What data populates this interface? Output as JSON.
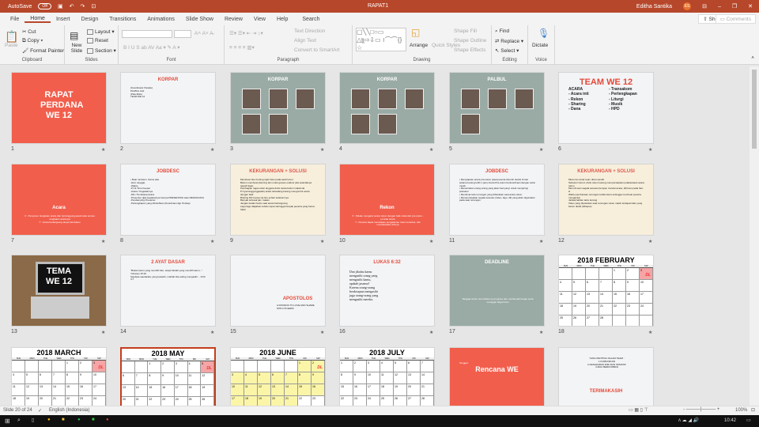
{
  "titlebar": {
    "autosave": "AutoSave",
    "autosave_state": "Off",
    "doc_title": "RAPAT1",
    "user": "Editha Santika",
    "user_initials": "ES"
  },
  "tabs": [
    "File",
    "Home",
    "Insert",
    "Design",
    "Transitions",
    "Animations",
    "Slide Show",
    "Review",
    "View",
    "Help",
    "Search"
  ],
  "share": "Share",
  "comments": "Comments",
  "ribbon": {
    "clipboard": {
      "label": "Clipboard",
      "paste": "Paste",
      "cut": "Cut",
      "copy": "Copy",
      "format_painter": "Format Painter"
    },
    "slides": {
      "label": "Slides",
      "new_slide": "New Slide",
      "layout": "Layout",
      "reset": "Reset",
      "section": "Section"
    },
    "font": {
      "label": "Font"
    },
    "paragraph": {
      "label": "Paragraph",
      "text_direction": "Text Direction",
      "align_text": "Align Text",
      "smartart": "Convert to SmartArt"
    },
    "drawing": {
      "label": "Drawing",
      "arrange": "Arrange",
      "quick_styles": "Quick Styles",
      "shape_fill": "Shape Fill",
      "shape_outline": "Shape Outline",
      "shape_effects": "Shape Effects"
    },
    "editing": {
      "label": "Editing",
      "find": "Find",
      "replace": "Replace",
      "select": "Select"
    },
    "voice": {
      "label": "Voice",
      "dictate": "Dictate"
    }
  },
  "colors": {
    "accent": "#b7472a",
    "coral": "#f25e4c",
    "sage": "#9aaba6",
    "cream": "#f7efdc",
    "light": "#f3f4f6"
  },
  "slides": [
    {
      "n": "1",
      "bg": "coral",
      "title": "RAPAT PERDANA WE 12"
    },
    {
      "n": "2",
      "bg": "light",
      "title": "KORPAR",
      "body": [
        "(Koordinator Parade)",
        "PALBUL 1&2",
        "(Palu-Bulu)",
        "TEAM WE 12"
      ]
    },
    {
      "n": "3",
      "bg": "sage",
      "title": "KORPAR",
      "photos": 5
    },
    {
      "n": "4",
      "bg": "sage",
      "title": "KORPAR",
      "photos": 5
    },
    {
      "n": "5",
      "bg": "sage",
      "title": "PALBUL",
      "photos": 4
    },
    {
      "n": "6",
      "bg": "light",
      "title": "TEAM WE 12",
      "body": [
        "ACARA",
        "- Acara inti",
        "- Rekon",
        "- Sharing",
        "- Dana",
        "- Transakom",
        "- Perlengkapan",
        "- Liturgi",
        "- Musik",
        "- HPD"
      ]
    },
    {
      "n": "7",
      "bg": "coral",
      "title": "Acara",
      "body": [
        "X : Penyusun rangkaian acara dan bertanggung jawab atas semua rangkaian acaranya",
        "Y : Acara berlangsung tanpa hambatan"
      ]
    },
    {
      "n": "8",
      "bg": "light",
      "title": "JOBDESC",
      "body": [
        "• Buat rundown. Harus ada",
        "-Hari, tanggal,",
        "-Waktu",
        "-PJ & Time Keeper",
        "-Acara / Kegiatannya",
        "-MC / Pembawa Acara",
        "-Presenter (jika kegiatannya berupa PRESENTASI atau RENUNGAN)",
        "-Pendamping Presenter",
        "-Perlengkapan yang dibutuhkan (Koordinasi dgn Perkap)"
      ]
    },
    {
      "n": "9",
      "bg": "cream",
      "title": "KEKURANGAN + SOLUSI",
      "body": [
        "Membuat clue hunting night baru pada saat hari-H",
        "Belum membuat planning lain untuk games outdoor jika seandainya terjadi hujan",
        "Pembagian tugas antar anggota divisi acara belum maksimal",
        "PJ (penanggungjawab) acara terkadang kurang mengontrol acara dengan baik",
        "Briefing MC hanya via line sehari sebelumnya",
        "Banyak terlewat jam makan",
        "Jangan terlalu hectic saat acara berlangsung",
        "Lagu-lagu diajarkan terlalu cepat sehingga banyak peserta yang belum hafal"
      ]
    },
    {
      "n": "10",
      "bg": "coral",
      "title": "Rekon",
      "body": [
        "X : Pelaku mengatur acara rekon dengan baik mulai dari pra rekon - puncak acara",
        "Y : Peserta dapat merasakan pengalaman rekon tersebut, dan memfleksikan dirinya"
      ]
    },
    {
      "n": "11",
      "bg": "light",
      "title": "JOBDESC",
      "body": [
        "• Menyiapkan acara pra-rekon (saat peserta disuruh duduk di luar selama kurang lebih 1 jam) Acara Pra-rekon berkoordinasi dengan seksi musik",
        "• Menentukan orang-orang yang akan bernyanyi untuk mengiringi prarekon",
        "• Membuat teks renungan yang dibacakan saat acara rekon",
        "• Mempersiapkan segala sesuatu (video, lagu, dll) yang akan digunakan pada saat renungan"
      ]
    },
    {
      "n": "12",
      "bg": "cream",
      "title": "KEKURANGAN + SOLUSI",
      "body": [
        "Miscomm antar team divisi sendiri.",
        "Sebelum hari-H, divisi rekon kurang mempersiapkan pelaksanaan acara rekon",
        "Mem-fix-kan segala sesuatu (tempat, transisi acara, dll) baru pada hari-H",
        "Waktu pembacaan renungan terlalu lama sehingga membuat peserta mengantuk",
        "Jadwal latihan taize kurang",
        "Video yang diputarkan saat renungan rekon masih terdapat iklan yang belum diedit (dihapus)"
      ]
    },
    {
      "n": "13",
      "bg": "photo",
      "title": "TEMA WE 12"
    },
    {
      "n": "14",
      "bg": "light",
      "title": "2 AYAT DASAR",
      "body": [
        "\"Bukan kamu yang memilih Aku, tetapi Akulah yang memilih kamu...\" Yohanes 15:16",
        "Saudara-saudaraku yang kekasih, marilah kita saling mengasihi... 1Yoh 4:7"
      ]
    },
    {
      "n": "15",
      "bg": "light",
      "title": "APOSTOLOS",
      "body": [
        "A PASSION TO LOVE AND SHARE WITH OTHERS!"
      ]
    },
    {
      "n": "16",
      "bg": "light",
      "title": "LUKAS 6:32",
      "body": [
        "Dan jikalau kamu mengasihi orang yang mengasihi kamu, apakah jasamu? Karena orang-orang berdosapun mengasihi juga orang-orang yang mengasihi mereka."
      ]
    },
    {
      "n": "17",
      "bg": "sage",
      "title": "DEADLINE",
      "body": [
        "Tanggal untuk mem-follow-up progress dan membenahi target serta mengejar target baru"
      ]
    },
    {
      "n": "18",
      "cal": {
        "title": "2018 FEBRUARY",
        "start": 4,
        "days": 28,
        "dl": [
          3
        ],
        "yellow": []
      }
    },
    {
      "n": "19",
      "cal": {
        "title": "2018 MARCH",
        "start": 4,
        "days": 31,
        "dl": [
          3
        ],
        "yellow": []
      }
    },
    {
      "n": "20",
      "selected": true,
      "cal": {
        "title": "2018 MAY",
        "start": 2,
        "days": 31,
        "dl": [
          5
        ],
        "yellow": []
      }
    },
    {
      "n": "21",
      "cal": {
        "title": "2018 JUNE",
        "start": 5,
        "days": 30,
        "dl": [
          2
        ],
        "yellow": [
          1,
          2,
          3,
          4,
          5,
          6,
          7,
          8,
          9,
          10,
          11,
          12,
          13,
          14,
          15,
          16,
          17,
          18,
          19,
          20,
          21
        ],
        "note": "PERKIRAAN TGL RAPAT"
      }
    },
    {
      "n": "22",
      "cal": {
        "title": "2018 JULY",
        "start": 0,
        "days": 31,
        "dl": [],
        "yellow": []
      }
    },
    {
      "n": "23",
      "bg": "coral",
      "title": "Rencana WE",
      "body": [
        "Tanggal :"
      ]
    },
    {
      "n": "24",
      "bg": "light",
      "title": "TERIMAKASIH",
      "body": [
        "YANG PENTING DALAM TEAM :",
        "1.KOMUNIKASI",
        "2.KESADARAN DIRI DAN INISIATIF",
        "3.MAU BERKORBAN"
      ]
    }
  ],
  "weekdays": [
    "SUN",
    "MON",
    "TUE",
    "WED",
    "THU",
    "FRI",
    "SAT"
  ],
  "dl_label": "DL",
  "status": {
    "slide": "Slide 20 of 24",
    "language": "English (Indonesia)",
    "zoom": "100%"
  },
  "taskbar": {
    "time": "10:42"
  }
}
